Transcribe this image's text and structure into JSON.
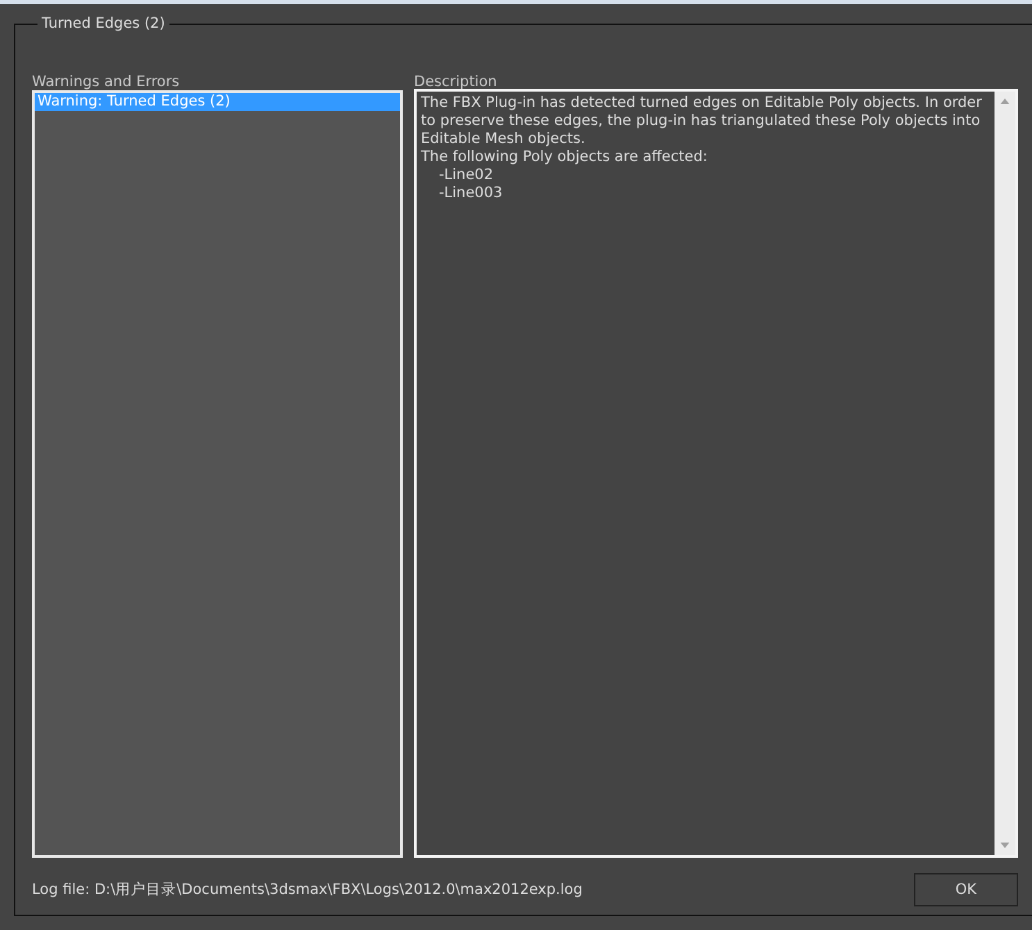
{
  "group_title": "Turned Edges (2)",
  "warnings": {
    "label": "Warnings and Errors",
    "items": [
      {
        "text": "Warning: Turned Edges (2)",
        "selected": true
      }
    ]
  },
  "description": {
    "label": "Description",
    "text": "The FBX Plug-in has detected turned edges on Editable Poly objects. In order to preserve these edges, the plug-in has triangulated these Poly objects into Editable Mesh objects.",
    "heading": "The following Poly objects are affected:",
    "affected": [
      "-Line02",
      "-Line003"
    ]
  },
  "log_file": "Log file: D:\\用户目录\\Documents\\3dsmax\\FBX\\Logs\\2012.0\\max2012exp.log",
  "buttons": [
    "OK"
  ]
}
